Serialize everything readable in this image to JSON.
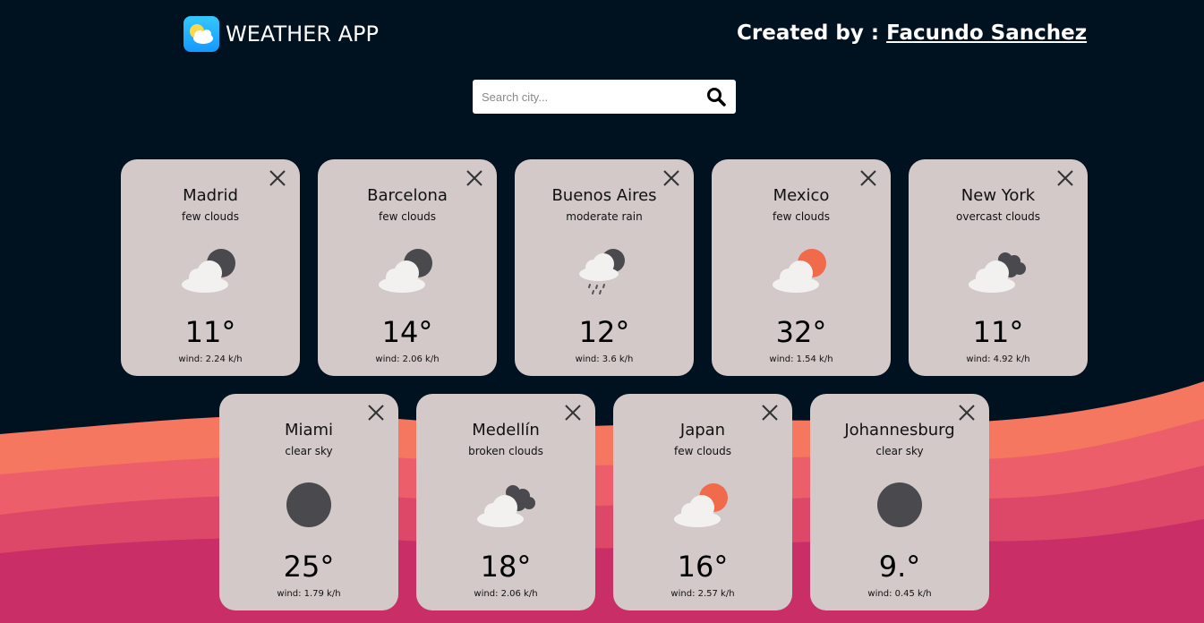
{
  "header": {
    "app_title": "WEATHER APP",
    "credit_prefix": "Created by :",
    "credit_name": "Facundo Sanchez"
  },
  "search": {
    "placeholder": "Search city..."
  },
  "colors": {
    "background": "#001220",
    "card": "#d2c9c8",
    "sun": "#ef6b4c",
    "dark_sun": "#4a4a4e",
    "cloud": "#f2f1ef"
  },
  "cards": [
    {
      "city": "Madrid",
      "description": "few clouds",
      "icon": "cloud-with-dark-sun-icon",
      "temp": "11°",
      "wind": "wind: 2.24 k/h"
    },
    {
      "city": "Barcelona",
      "description": "few clouds",
      "icon": "cloud-with-dark-sun-icon",
      "temp": "14°",
      "wind": "wind: 2.06 k/h"
    },
    {
      "city": "Buenos Aires",
      "description": "moderate rain",
      "icon": "rain-cloud-icon",
      "temp": "12°",
      "wind": "wind: 3.6 k/h"
    },
    {
      "city": "Mexico",
      "description": "few clouds",
      "icon": "cloud-with-sun-icon",
      "temp": "32°",
      "wind": "wind: 1.54 k/h"
    },
    {
      "city": "New York",
      "description": "overcast clouds",
      "icon": "overcast-clouds-icon",
      "temp": "11°",
      "wind": "wind: 4.92 k/h"
    },
    {
      "city": "Miami",
      "description": "clear sky",
      "icon": "clear-sky-icon",
      "temp": "25°",
      "wind": "wind: 1.79 k/h"
    },
    {
      "city": "Medellín",
      "description": "broken clouds",
      "icon": "broken-clouds-icon",
      "temp": "18°",
      "wind": "wind: 2.06 k/h"
    },
    {
      "city": "Japan",
      "description": "few clouds",
      "icon": "cloud-with-sun-icon",
      "temp": "16°",
      "wind": "wind: 2.57 k/h"
    },
    {
      "city": "Johannesburg",
      "description": "clear sky",
      "icon": "clear-sky-icon",
      "temp": "9.°",
      "wind": "wind: 0.45 k/h"
    }
  ]
}
